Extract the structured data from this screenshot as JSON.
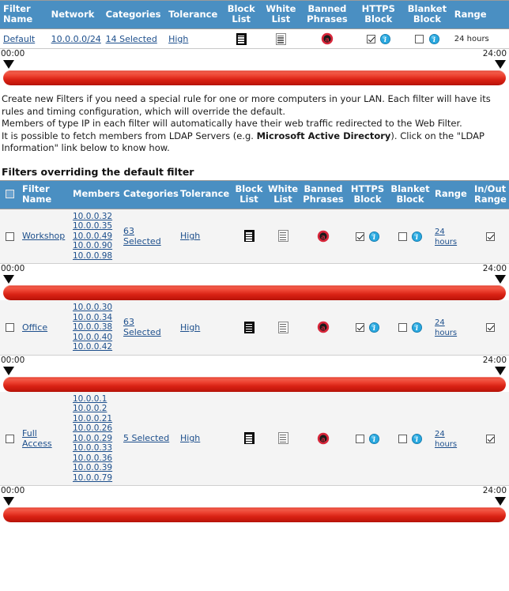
{
  "default_table": {
    "name": "default-filter-table",
    "columns": [
      {
        "key": "filter_name",
        "label": "Filter Name"
      },
      {
        "key": "network",
        "label": "Network"
      },
      {
        "key": "categories",
        "label": "Categories"
      },
      {
        "key": "tolerance",
        "label": "Tolerance"
      },
      {
        "key": "block_list",
        "label": "Block List"
      },
      {
        "key": "white_list",
        "label": "White List"
      },
      {
        "key": "banned_phrases",
        "label": "Banned Phrases"
      },
      {
        "key": "https_block",
        "label": "HTTPS Block"
      },
      {
        "key": "blanket_block",
        "label": "Blanket Block"
      },
      {
        "key": "range",
        "label": "Range"
      }
    ],
    "row": {
      "filter_name": "Default",
      "network": "10.0.0.0/24",
      "categories": "14 Selected",
      "tolerance": "High",
      "block_list_icon": "block-list-icon",
      "white_list_icon": "white-list-icon",
      "banned_phrases_icon": "banned-phrases-icon",
      "https_block_checked": true,
      "blanket_block_checked": false,
      "range": "24 hours"
    },
    "timeline": {
      "start": "00:00",
      "end": "24:00"
    }
  },
  "blurb": {
    "line1": "Create new Filters if you need a special rule for one or more computers in your LAN. Each filter will have its rules and timing configuration, which will override the default.",
    "line2": "Members of type IP in each filter will automatically have their web traffic redirected to the Web Filter.",
    "line3_a": "It is possible to fetch members from LDAP Servers (e.g. ",
    "line3_bold": "Microsoft Active Directory",
    "line3_b": "). Click on the \"LDAP Information\" link below to know how."
  },
  "section_title": "Filters overriding the default filter",
  "overrides_table": {
    "name": "override-filters-table",
    "columns": [
      {
        "key": "select",
        "label": ""
      },
      {
        "key": "filter_name",
        "label": "Filter Name"
      },
      {
        "key": "members",
        "label": "Members"
      },
      {
        "key": "categories",
        "label": "Categories"
      },
      {
        "key": "tolerance",
        "label": "Tolerance"
      },
      {
        "key": "block_list",
        "label": "Block List"
      },
      {
        "key": "white_list",
        "label": "White List"
      },
      {
        "key": "banned_phrases",
        "label": "Banned Phrases"
      },
      {
        "key": "https_block",
        "label": "HTTPS Block"
      },
      {
        "key": "blanket_block",
        "label": "Blanket Block"
      },
      {
        "key": "range",
        "label": "Range"
      },
      {
        "key": "in_out_range",
        "label": "In/Out Range"
      }
    ],
    "rows": [
      {
        "selected": false,
        "filter_name": "Workshop",
        "members": [
          "10.0.0.32",
          "10.0.0.35",
          "10.0.0.49",
          "10.0.0.90",
          "10.0.0.98"
        ],
        "categories": "63 Selected",
        "tolerance": "High",
        "https_block_checked": true,
        "blanket_block_checked": false,
        "range": "24 hours",
        "in_out_range_checked": true,
        "timeline": {
          "start": "00:00",
          "end": "24:00"
        }
      },
      {
        "selected": false,
        "filter_name": "Office",
        "members": [
          "10.0.0.30",
          "10.0.0.34",
          "10.0.0.38",
          "10.0.0.40",
          "10.0.0.42"
        ],
        "categories": "63 Selected",
        "tolerance": "High",
        "https_block_checked": true,
        "blanket_block_checked": false,
        "range": "24 hours",
        "in_out_range_checked": true,
        "timeline": {
          "start": "00:00",
          "end": "24:00"
        }
      },
      {
        "selected": false,
        "filter_name": "Full Access",
        "members": [
          "10.0.0.1",
          "10.0.0.2",
          "10.0.0.21",
          "10.0.0.26",
          "10.0.0.29",
          "10.0.0.33",
          "10.0.0.36",
          "10.0.0.39",
          "10.0.0.79"
        ],
        "categories": "5 Selected",
        "tolerance": "High",
        "https_block_checked": false,
        "blanket_block_checked": false,
        "range": "24 hours",
        "in_out_range_checked": true,
        "timeline": {
          "start": "00:00",
          "end": "24:00"
        }
      }
    ]
  },
  "colors": {
    "header_blue": "#4a8fc2",
    "link_blue": "#1d4f8c",
    "slider_red": "#d92214",
    "info_icon_cyan": "#29a8df",
    "row_gray": "#f4f4f4"
  }
}
